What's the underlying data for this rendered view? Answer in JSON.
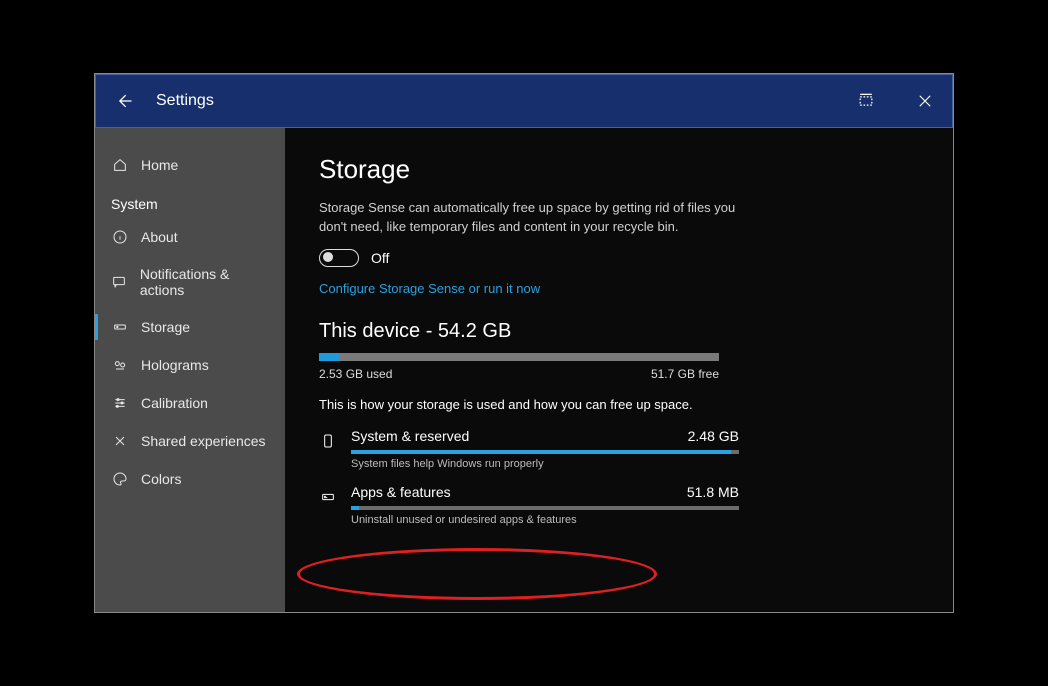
{
  "titlebar": {
    "title": "Settings"
  },
  "sidebar": {
    "home": "Home",
    "section": "System",
    "items": [
      {
        "id": "about",
        "label": "About",
        "icon": "info-icon"
      },
      {
        "id": "notifications",
        "label": "Notifications & actions",
        "icon": "comment-icon"
      },
      {
        "id": "storage",
        "label": "Storage",
        "icon": "drive-icon",
        "active": true
      },
      {
        "id": "holograms",
        "label": "Holograms",
        "icon": "holograms-icon"
      },
      {
        "id": "calibration",
        "label": "Calibration",
        "icon": "sliders-icon"
      },
      {
        "id": "shared",
        "label": "Shared experiences",
        "icon": "share-icon"
      },
      {
        "id": "colors",
        "label": "Colors",
        "icon": "palette-icon"
      }
    ]
  },
  "storage": {
    "heading": "Storage",
    "senseDescription": "Storage Sense can automatically free up space by getting rid of files you don't need, like temporary files and content in your recycle bin.",
    "toggleState": "Off",
    "configureLink": "Configure Storage Sense or run it now",
    "deviceHeading": "This device - 54.2 GB",
    "usedLabel": "2.53 GB used",
    "freeLabel": "51.7 GB free",
    "usedFractionPercent": 5,
    "explanation": "This is how your storage is used and how you can free up space.",
    "categories": [
      {
        "name": "System & reserved",
        "size": "2.48 GB",
        "sub": "System files help Windows run properly",
        "fillPercent": 98
      },
      {
        "name": "Apps & features",
        "size": "51.8 MB",
        "sub": "Uninstall unused or undesired apps & features",
        "fillPercent": 2
      }
    ]
  }
}
